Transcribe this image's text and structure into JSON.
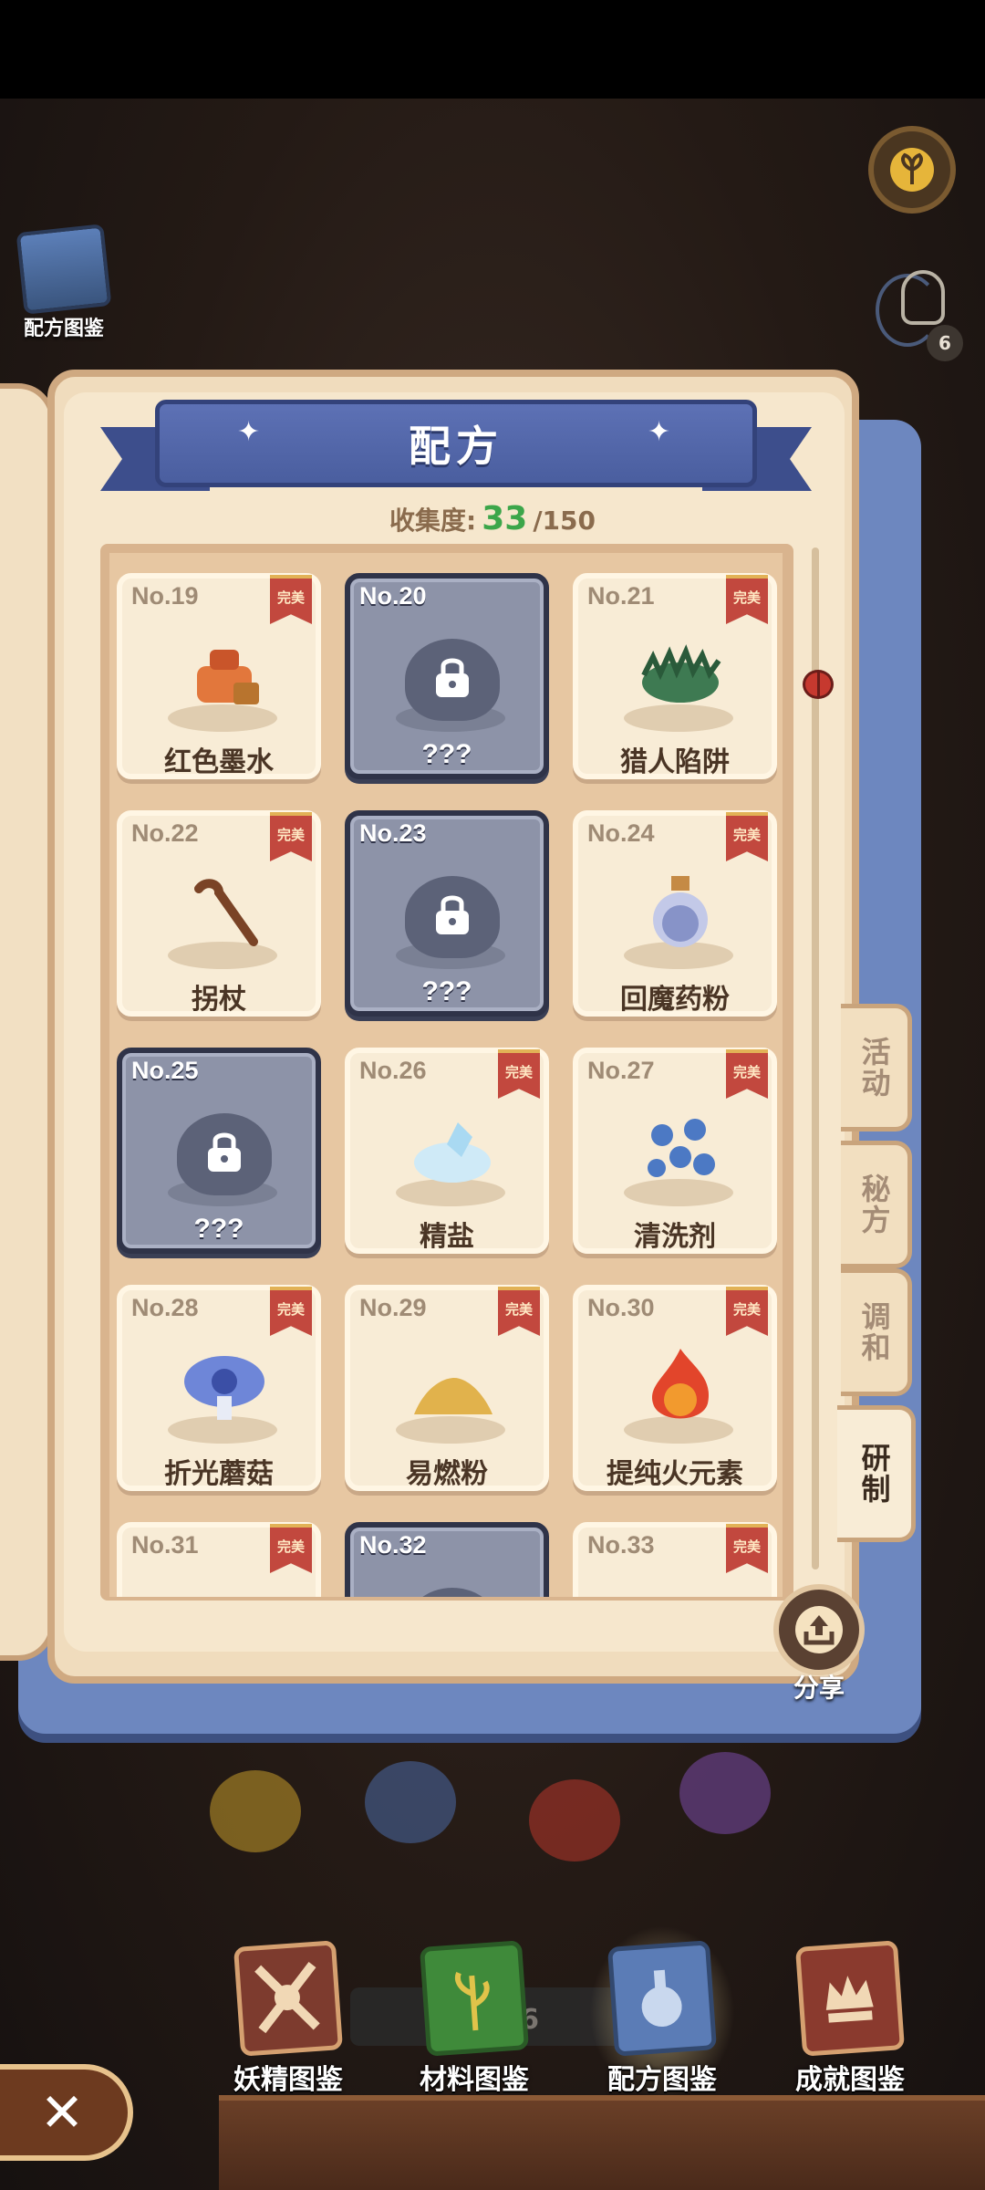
{
  "hud": {
    "recipe_book_label": "配方图鉴",
    "hint_count": "6"
  },
  "book": {
    "title": "配方",
    "collection_label": "收集度:",
    "collection_current": "33",
    "collection_total": "/150",
    "perfect_badge": "完美"
  },
  "cards": [
    {
      "num": "No.19",
      "name": "红色墨水",
      "locked": false,
      "perfect": true,
      "icon": "red-ink-icon"
    },
    {
      "num": "No.20",
      "name": "???",
      "locked": true,
      "perfect": false,
      "icon": "lock-icon"
    },
    {
      "num": "No.21",
      "name": "猎人陷阱",
      "locked": false,
      "perfect": true,
      "icon": "bear-trap-icon"
    },
    {
      "num": "No.22",
      "name": "拐杖",
      "locked": false,
      "perfect": true,
      "icon": "cane-icon"
    },
    {
      "num": "No.23",
      "name": "???",
      "locked": true,
      "perfect": false,
      "icon": "lock-icon"
    },
    {
      "num": "No.24",
      "name": "回魔药粉",
      "locked": false,
      "perfect": true,
      "icon": "potion-bottle-icon"
    },
    {
      "num": "No.25",
      "name": "???",
      "locked": true,
      "perfect": false,
      "icon": "lock-icon"
    },
    {
      "num": "No.26",
      "name": "精盐",
      "locked": false,
      "perfect": true,
      "icon": "salt-crystal-icon"
    },
    {
      "num": "No.27",
      "name": "清洗剂",
      "locked": false,
      "perfect": true,
      "icon": "blue-flakes-icon"
    },
    {
      "num": "No.28",
      "name": "折光蘑菇",
      "locked": false,
      "perfect": true,
      "icon": "blue-mushroom-icon"
    },
    {
      "num": "No.29",
      "name": "易燃粉",
      "locked": false,
      "perfect": true,
      "icon": "powder-pile-icon"
    },
    {
      "num": "No.30",
      "name": "提纯火元素",
      "locked": false,
      "perfect": true,
      "icon": "fire-element-icon"
    },
    {
      "num": "No.31",
      "name": "",
      "locked": false,
      "perfect": true,
      "icon": "candle-icon"
    },
    {
      "num": "No.32",
      "name": "",
      "locked": true,
      "perfect": false,
      "icon": "lock-icon"
    },
    {
      "num": "No.33",
      "name": "",
      "locked": false,
      "perfect": true,
      "icon": "purple-item-icon"
    }
  ],
  "tabs": [
    {
      "label": "活动",
      "active": false
    },
    {
      "label": "秘方",
      "active": false
    },
    {
      "label": "调和",
      "active": false
    },
    {
      "label": "研制",
      "active": true
    }
  ],
  "share_label": "分享",
  "bottom_count": "收     /186",
  "nav": [
    {
      "label": "妖精图鉴",
      "active": false
    },
    {
      "label": "材料图鉴",
      "active": false
    },
    {
      "label": "配方图鉴",
      "active": true
    },
    {
      "label": "成就图鉴",
      "active": false
    }
  ],
  "colors": {
    "ribbon": "#4a5e9f",
    "collection_current": "#3ca64a",
    "perfect_badge": "#c2483e",
    "locked_card": "#8d93a8"
  }
}
